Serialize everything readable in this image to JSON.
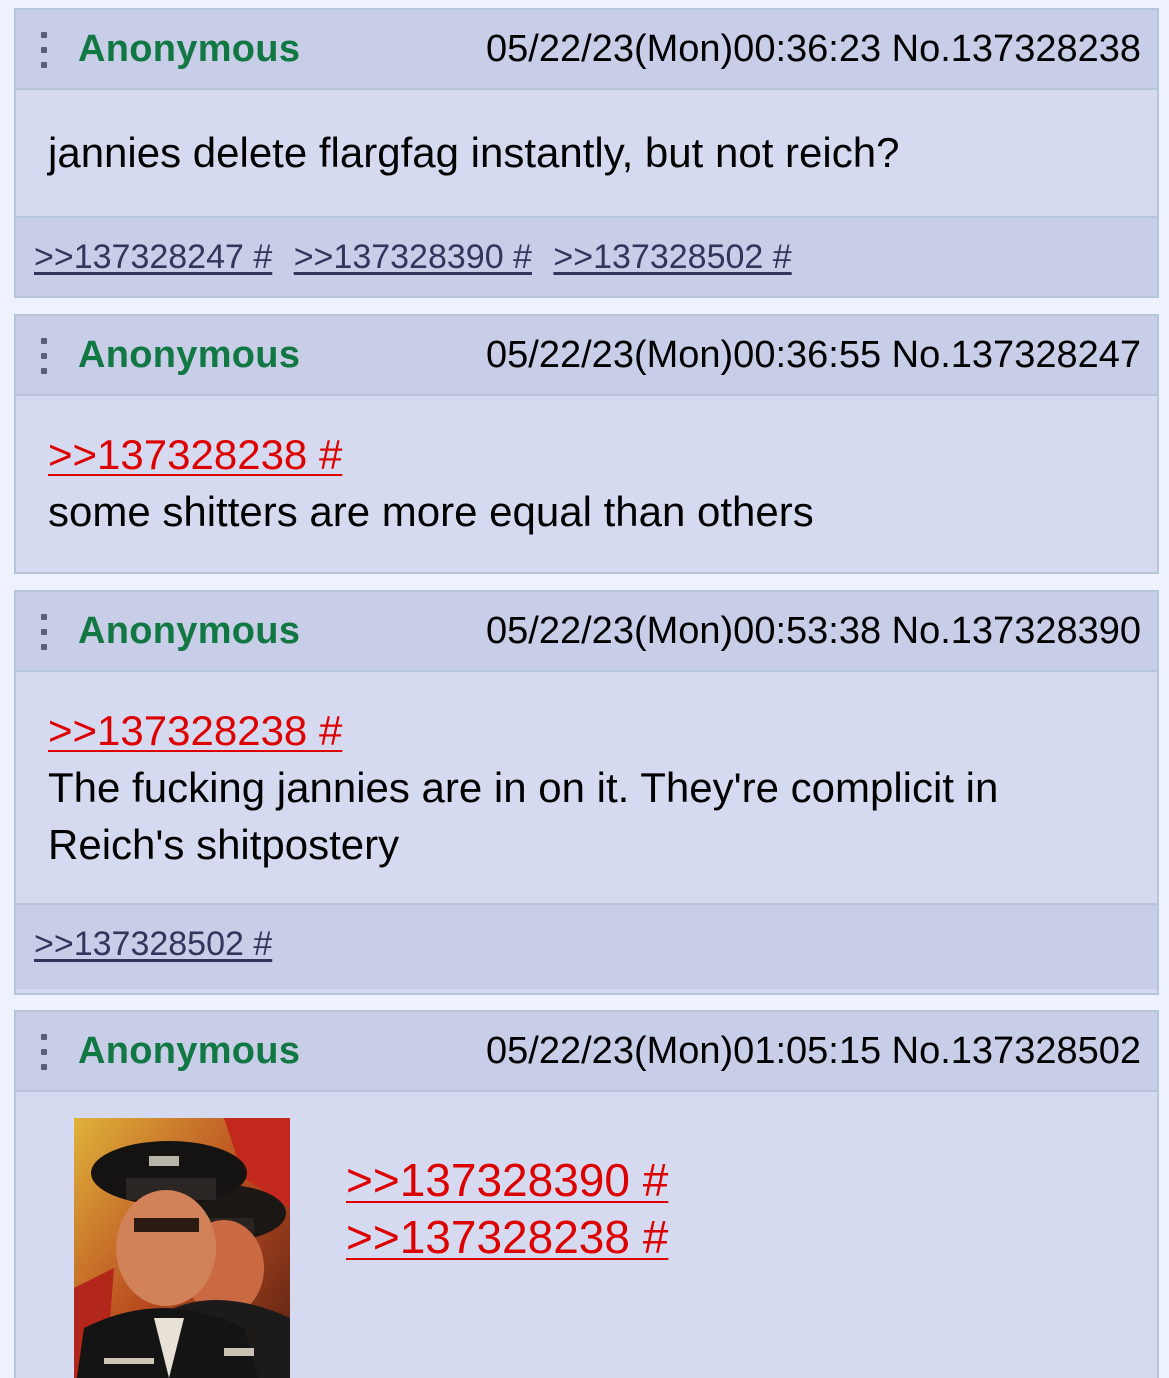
{
  "thread": {
    "posts": [
      {
        "name": "Anonymous",
        "meta": "05/22/23(Mon)00:36:23 No.137328238",
        "body_lines": [
          "jannies delete flargfag instantly, but not reich?"
        ],
        "replies": [
          ">>137328247 #",
          ">>137328390 #",
          ">>137328502 #"
        ]
      },
      {
        "name": "Anonymous",
        "meta": "05/22/23(Mon)00:36:55 No.137328247",
        "quotes": [
          ">>137328238 #"
        ],
        "body_lines": [
          "some shitters are more equal than others"
        ]
      },
      {
        "name": "Anonymous",
        "meta": "05/22/23(Mon)00:53:38 No.137328390",
        "quotes": [
          ">>137328238 #"
        ],
        "body_lines": [
          "The fucking jannies are in on it. They're complicit in",
          "Reich's shitpostery"
        ],
        "replies": [
          ">>137328502 #"
        ]
      },
      {
        "name": "Anonymous",
        "meta": "05/22/23(Mon)01:05:15 No.137328502",
        "quotes": [
          ">>137328390 #",
          ">>137328238 #"
        ],
        "image": "propaganda-poster-thumbnail"
      }
    ]
  },
  "colors": {
    "page_bg": "#eef2ff",
    "post_bg": "#d6daf0",
    "header_bg": "#c8cde8",
    "border": "#b7c5d9",
    "name": "#117743",
    "quote_link": "#dd0000",
    "reply_link": "#34345c"
  },
  "icons": {
    "post_menu": "vertical-ellipsis-icon"
  }
}
